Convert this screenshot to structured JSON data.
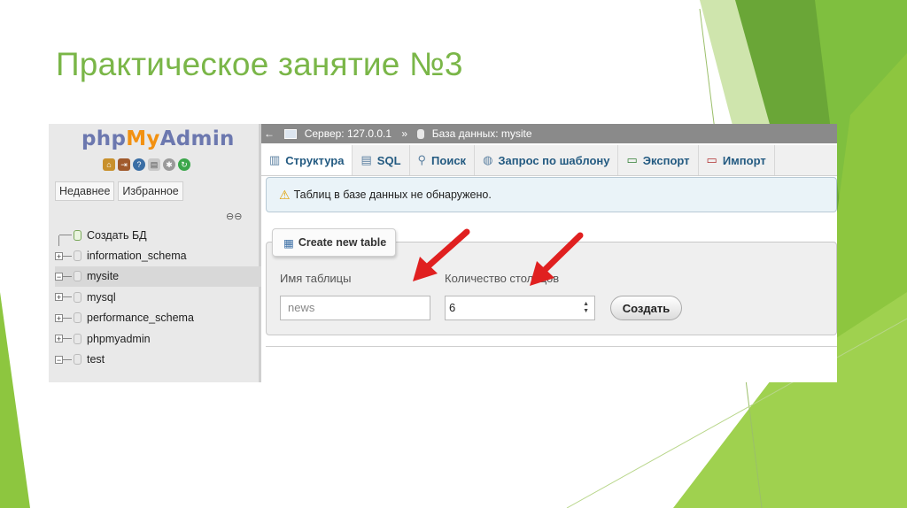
{
  "slide": {
    "title": "Практическое занятие №3"
  },
  "sidebar": {
    "logo": {
      "php": "php",
      "my": "My",
      "admin": "Admin"
    },
    "icons": [
      "home-icon",
      "exit-icon",
      "help-icon",
      "docs-icon",
      "settings-icon",
      "refresh-icon"
    ],
    "tabs": [
      "Недавнее",
      "Избранное"
    ],
    "link_icon": "link-icon",
    "tree": [
      {
        "label": "Создать БД",
        "kind": "new"
      },
      {
        "label": "information_schema",
        "kind": "db"
      },
      {
        "label": "mysite",
        "kind": "db-open"
      },
      {
        "label": "mysql",
        "kind": "db"
      },
      {
        "label": "performance_schema",
        "kind": "db"
      },
      {
        "label": "phpmyadmin",
        "kind": "db"
      },
      {
        "label": "test",
        "kind": "db-open"
      }
    ]
  },
  "breadcrumb": {
    "arrow": "←",
    "server": "Сервер: 127.0.0.1",
    "sep": "»",
    "database": "База данных: mysite"
  },
  "tabs": [
    {
      "label": "Структура",
      "icon": "structure-icon"
    },
    {
      "label": "SQL",
      "icon": "sql-icon"
    },
    {
      "label": "Поиск",
      "icon": "search-icon"
    },
    {
      "label": "Запрос по шаблону",
      "icon": "query-icon"
    },
    {
      "label": "Экспорт",
      "icon": "export-icon"
    },
    {
      "label": "Импорт",
      "icon": "import-icon"
    }
  ],
  "notice": {
    "text": "Таблиц в базе данных не обнаружено."
  },
  "create_form": {
    "legend": "Create new table",
    "name_label": "Имя таблицы",
    "name_value": "news",
    "columns_label": "Количество столбцов",
    "columns_value": "6",
    "submit": "Создать"
  },
  "colors": {
    "title": "#7ab648",
    "accent_green": "#8dc63f",
    "arrow_red": "#e02020",
    "link_blue": "#235a81"
  }
}
